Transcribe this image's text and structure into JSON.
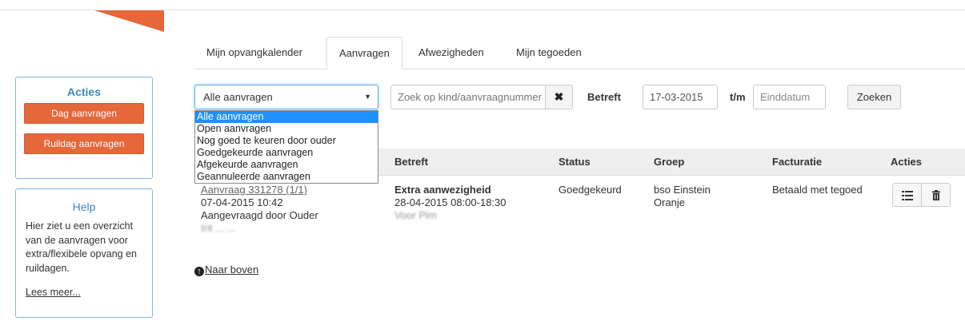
{
  "colors": {
    "accent_orange": "#e5673a",
    "link_blue": "#3a89c0",
    "select_highlight": "#1e90ff"
  },
  "sidebar": {
    "acties": {
      "title": "Acties",
      "buttons": [
        "Dag aanvragen",
        "Ruildag aanvragen"
      ]
    },
    "help": {
      "title": "Help",
      "text": "Hier ziet u een overzicht van de aanvragen voor extra/flexibele opvang en ruildagen.",
      "link": "Lees meer..."
    }
  },
  "tabs": [
    {
      "label": "Mijn opvangkalender",
      "active": false
    },
    {
      "label": "Aanvragen",
      "active": true
    },
    {
      "label": "Afwezigheden",
      "active": false
    },
    {
      "label": "Mijn tegoeden",
      "active": false
    }
  ],
  "filters": {
    "status_select": {
      "value": "Alle aanvragen",
      "options": [
        "Alle aanvragen",
        "Open aanvragen",
        "Nog goed te keuren door ouder",
        "Goedgekeurde aanvragen",
        "Afgekeurde aanvragen",
        "Geannuleerde aanvragen"
      ]
    },
    "search_placeholder": "Zoek op kind/aanvraagnummer",
    "betreft_label": "Betreft",
    "from_date": "17-03-2015",
    "tm_label": "t/m",
    "to_date_placeholder": "Einddatum",
    "search_button": "Zoeken"
  },
  "table": {
    "headers": [
      "Betreft",
      "Status",
      "Groep",
      "Facturatie",
      "Acties"
    ],
    "rows": [
      {
        "request_link": "Aanvraag 331278 (1/1)",
        "request_datetime": "07-04-2015 10:42",
        "requested_by": "Aangevraagd door Ouder",
        "requester_name_blurred": "Irit ... ...",
        "betreft_title": "Extra aanwezigheid",
        "betreft_time": "28-04-2015 08:00-18:30",
        "betreft_child": "Voor Pim",
        "status": "Goedgekeurd",
        "groep": [
          "bso Einstein",
          "Oranje"
        ],
        "facturatie": "Betaald met tegoed",
        "actions": [
          "list-icon",
          "trash-icon"
        ]
      }
    ]
  },
  "footer_link": "Naar boven"
}
